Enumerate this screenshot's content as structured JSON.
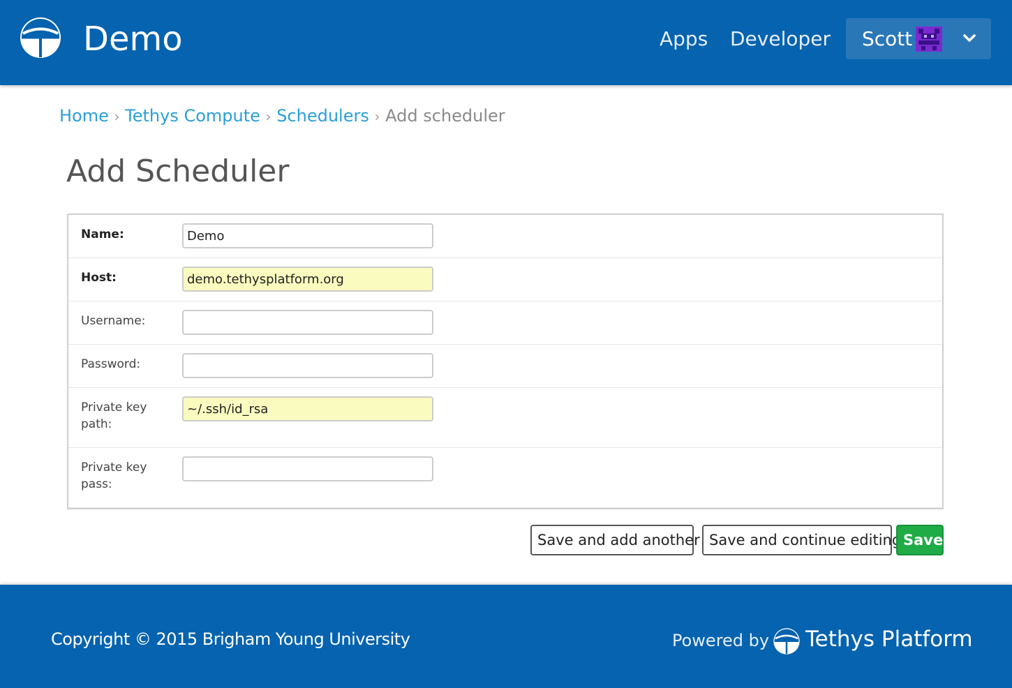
{
  "header": {
    "site_title": "Demo",
    "nav": {
      "apps": "Apps",
      "developer": "Developer"
    },
    "user": {
      "name": "Scott"
    }
  },
  "breadcrumb": {
    "home": "Home",
    "compute": "Tethys Compute",
    "schedulers": "Schedulers",
    "separator": "›",
    "current": "Add scheduler"
  },
  "page": {
    "title": "Add Scheduler"
  },
  "form": {
    "fields": [
      {
        "label": "Name:",
        "value": "Demo",
        "required": true
      },
      {
        "label": "Host:",
        "value": "demo.tethysplatform.org",
        "required": true
      },
      {
        "label": "Username:",
        "value": "",
        "required": false
      },
      {
        "label": "Password:",
        "value": "",
        "required": false
      },
      {
        "label": "Private key path:",
        "value": "~/.ssh/id_rsa",
        "required": false
      },
      {
        "label": "Private key pass:",
        "value": "",
        "required": false
      }
    ]
  },
  "actions": {
    "save_add_another": "Save and add another",
    "save_continue": "Save and continue editing",
    "save": "Save"
  },
  "footer": {
    "copyright": "Copyright © 2015 Brigham Young University",
    "powered_by": "Powered by",
    "brand": "Tethys Platform"
  },
  "colors": {
    "brand_blue": "#0563af",
    "link_blue": "#2a9fd8",
    "save_green": "#1fab45",
    "autofill_yellow": "#fafbbf"
  }
}
